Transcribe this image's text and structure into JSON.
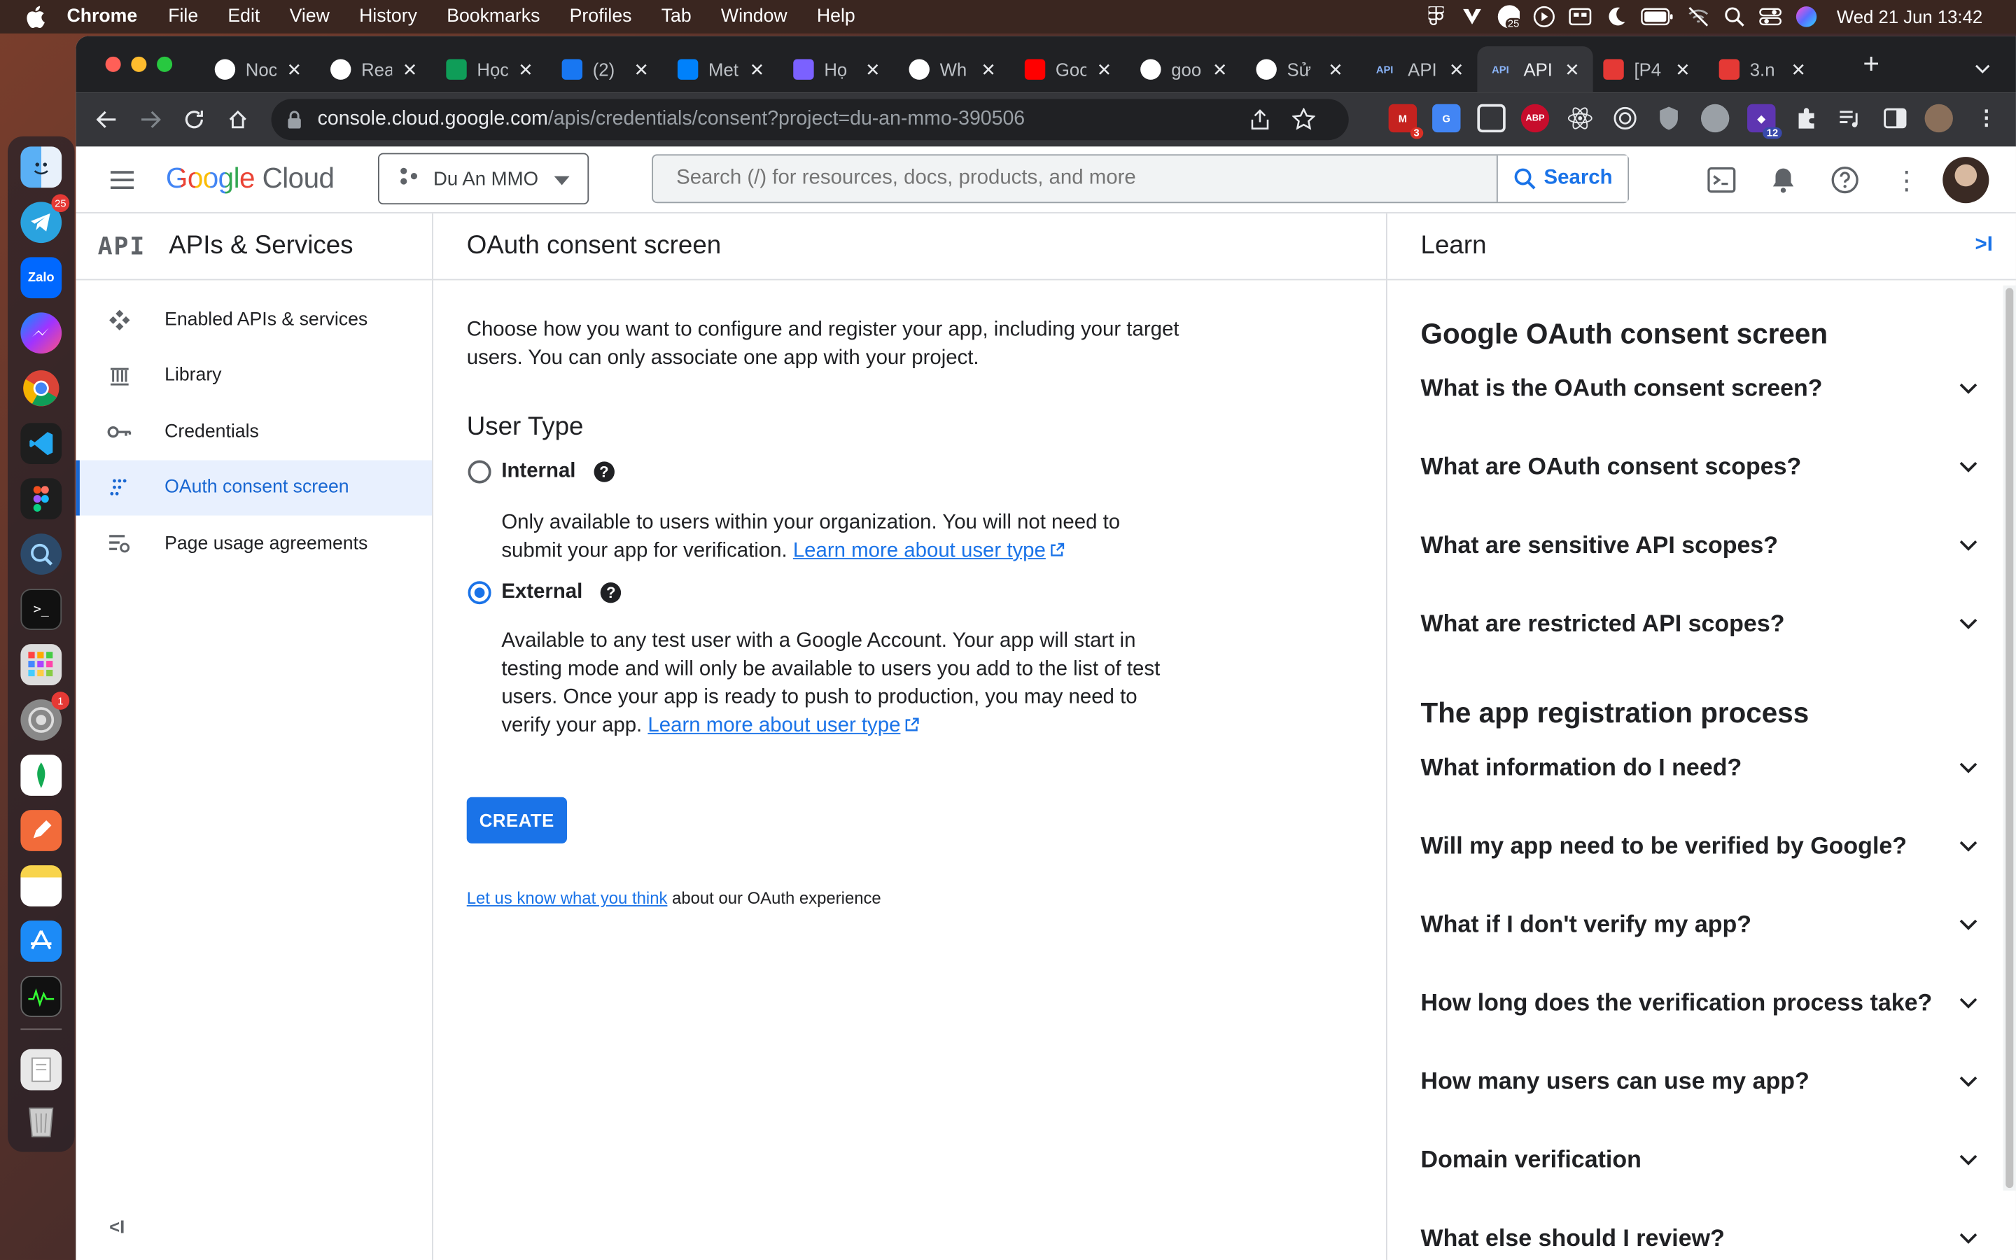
{
  "menubar": {
    "app": "Chrome",
    "items": [
      "File",
      "Edit",
      "View",
      "History",
      "Bookmarks",
      "Profiles",
      "Tab",
      "Window",
      "Help"
    ],
    "clock": "Wed 21 Jun  13:42",
    "icons": [
      "figma-icon",
      "v-icon",
      "badge-25-icon",
      "play-icon",
      "display-icon",
      "moon-icon",
      "battery-icon",
      "wifi-off-icon",
      "search-icon",
      "control-center-icon",
      "siri-icon"
    ],
    "badge": "25"
  },
  "dock": {
    "telegram_badge": "25",
    "settings_badge": "1"
  },
  "tabs": [
    {
      "title": "Noc",
      "icon": "github-icon",
      "color": "#ffffff"
    },
    {
      "title": "Rea",
      "icon": "github-icon",
      "color": "#ffffff"
    },
    {
      "title": "Học",
      "icon": "sheets-icon",
      "color": "#0f9d58"
    },
    {
      "title": "(2)",
      "icon": "facebook-icon",
      "color": "#1877f2"
    },
    {
      "title": "Met",
      "icon": "meta-icon",
      "color": "#0081fb"
    },
    {
      "title": "Họ",
      "icon": "apollo-icon",
      "color": "#7b61ff"
    },
    {
      "title": "Wh",
      "icon": "shield-icon",
      "color": "#ffffff"
    },
    {
      "title": "Goo",
      "icon": "youtube-icon",
      "color": "#ff0000"
    },
    {
      "title": "goo",
      "icon": "google-icon",
      "color": "#ffffff"
    },
    {
      "title": "Sử",
      "icon": "google-icon",
      "color": "#ffffff"
    },
    {
      "title": "API",
      "icon": "api-icon",
      "color": "#8ab4f8"
    },
    {
      "title": "API",
      "icon": "api-icon",
      "color": "#8ab4f8"
    },
    {
      "title": "[P4",
      "icon": "dtd-icon",
      "color": "#e53935"
    },
    {
      "title": "3.n",
      "icon": "dtd-icon",
      "color": "#e53935"
    }
  ],
  "url": {
    "host": "console.cloud.google.com",
    "path": "/apis/credentials/consent?project=du-an-mmo-390506"
  },
  "extensions": {
    "gmail_badge": "3",
    "abp_label": "ABP",
    "ext_badge": "12"
  },
  "gcp": {
    "logo_google": "Google",
    "logo_cloud": "Cloud",
    "project": "Du An MMO",
    "search_placeholder": "Search (/) for resources, docs, products, and more",
    "search_button": "Search"
  },
  "sidebar": {
    "icon_text": "API",
    "title": "APIs & Services",
    "items": [
      {
        "label": "Enabled APIs & services",
        "icon": "diamond-icon"
      },
      {
        "label": "Library",
        "icon": "library-icon"
      },
      {
        "label": "Credentials",
        "icon": "key-icon"
      },
      {
        "label": "OAuth consent screen",
        "icon": "consent-icon",
        "active": true
      },
      {
        "label": "Page usage agreements",
        "icon": "settings-list-icon"
      }
    ],
    "collapse": "<I"
  },
  "main": {
    "title": "OAuth consent screen",
    "description": "Choose how you want to configure and register your app, including your target users. You can only associate one app with your project.",
    "user_type_heading": "User Type",
    "internal_label": "Internal",
    "internal_desc": "Only available to users within your organization. You will not need to submit your app for verification.",
    "internal_link": "Learn more about user type",
    "external_label": "External",
    "external_desc": "Available to any test user with a Google Account. Your app will start in testing mode and will only be available to users you add to the list of test users. Once your app is ready to push to production, you may need to verify your app.",
    "external_link": "Learn more about user type",
    "create_button": "CREATE",
    "feedback_link": "Let us know what you think",
    "feedback_text": " about our OAuth experience"
  },
  "learn": {
    "title": "Learn",
    "close": ">I",
    "section1": "Google OAuth consent screen",
    "section1_items": [
      "What is the OAuth consent screen?",
      "What are OAuth consent scopes?",
      "What are sensitive API scopes?",
      "What are restricted API scopes?"
    ],
    "section2": "The app registration process",
    "section2_items": [
      "What information do I need?",
      "Will my app need to be verified by Google?",
      "What if I don't verify my app?",
      "How long does the verification process take?",
      "How many users can use my app?",
      "Domain verification",
      "What else should I review?"
    ]
  }
}
